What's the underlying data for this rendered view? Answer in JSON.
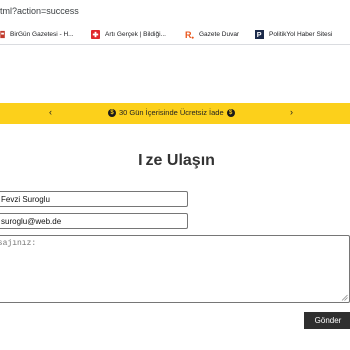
{
  "browser": {
    "address": "tml?action=success",
    "bookmarks": [
      {
        "label": "BirGün Gazetesi - H...",
        "icon": "birgun-favicon-icon"
      },
      {
        "label": "Artı Gerçek | Bildiği...",
        "icon": "arti-gercek-favicon-icon"
      },
      {
        "label": "Gazete Duvar",
        "icon": "gazete-duvar-favicon-icon"
      },
      {
        "label": "PolitikYol Haber Sitesi",
        "icon": "politikyol-favicon-icon"
      }
    ]
  },
  "promo": {
    "text": "30 Gün İçerisinde Ücretsiz İade",
    "coin_symbol": "$",
    "left_arrow": "‹",
    "right_arrow": "›",
    "background": "#fcd01b"
  },
  "contact": {
    "title_prefix": "I",
    "title_main": "ze Ulaşın",
    "name_value": "Fevzi Suroglu",
    "email_value": "suroglu@web.de",
    "message_placeholder": "esajınız:",
    "submit_label": "Gönder"
  },
  "colors": {
    "accent": "#fcd01b",
    "button": "#2f2f2f",
    "title": "#333333"
  }
}
